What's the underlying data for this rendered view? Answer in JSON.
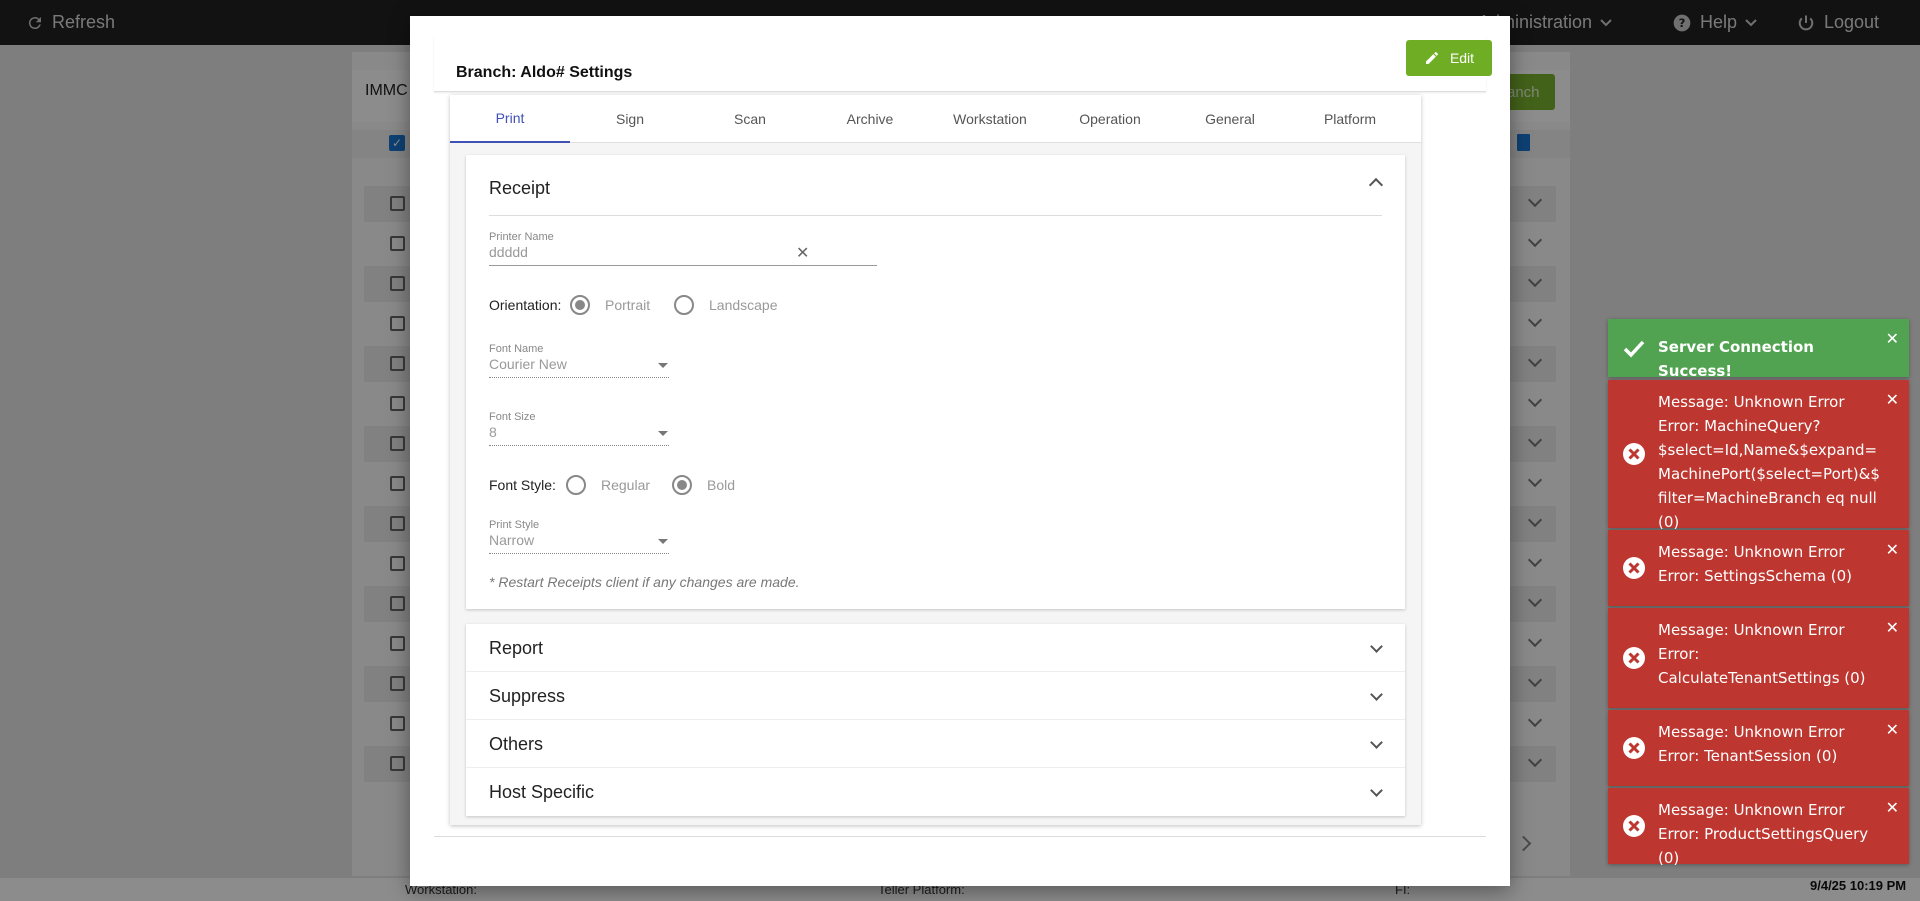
{
  "topbar": {
    "refresh": "Refresh",
    "administration": "Administration",
    "help": "Help",
    "logout": "Logout"
  },
  "background": {
    "search_text": "IMMC",
    "action_button": "anch",
    "footer": {
      "left": "Workstation:",
      "middle": "Teller Platform:",
      "right": "FI:"
    },
    "row_count": 15
  },
  "modal": {
    "title": "Branch: Aldo# Settings",
    "edit_label": "Edit",
    "tabs": [
      "Print",
      "Sign",
      "Scan",
      "Archive",
      "Workstation",
      "Operation",
      "General",
      "Platform"
    ],
    "active_tab": "Print",
    "receipt": {
      "title": "Receipt",
      "printer_name": {
        "label": "Printer Name",
        "value": "ddddd"
      },
      "orientation": {
        "label": "Orientation:",
        "options": [
          "Portrait",
          "Landscape"
        ],
        "selected": "Portrait"
      },
      "font_name": {
        "label": "Font Name",
        "value": "Courier New"
      },
      "font_size": {
        "label": "Font Size",
        "value": "8"
      },
      "font_style": {
        "label": "Font Style:",
        "options": [
          "Regular",
          "Bold"
        ],
        "selected": "Bold"
      },
      "print_style": {
        "label": "Print Style",
        "value": "Narrow"
      },
      "note": "* Restart Receipts client if any changes are made."
    },
    "sections": [
      "Report",
      "Suppress",
      "Others",
      "Host Specific"
    ]
  },
  "toasts": [
    {
      "type": "success",
      "text": "Server Connection Success!"
    },
    {
      "type": "error",
      "text": "Message: Unknown Error Error: MachineQuery?$select=Id,Name&$expand=MachinePort($select=Port)&$filter=MachineBranch eq null (0)"
    },
    {
      "type": "error",
      "text": "Message: Unknown Error Error: SettingsSchema (0)"
    },
    {
      "type": "error",
      "text": "Message: Unknown Error Error: CalculateTenantSettings (0)"
    },
    {
      "type": "error",
      "text": "Message: Unknown Error Error: TenantSession (0)"
    },
    {
      "type": "error",
      "text": "Message: Unknown Error Error: ProductSettingsQuery (0)"
    }
  ],
  "clock": "9/4/25 10:19 PM",
  "colors": {
    "accent": "#3f51b5",
    "edit": "#6fae24",
    "success": "#51a351",
    "error": "#bd362f"
  }
}
